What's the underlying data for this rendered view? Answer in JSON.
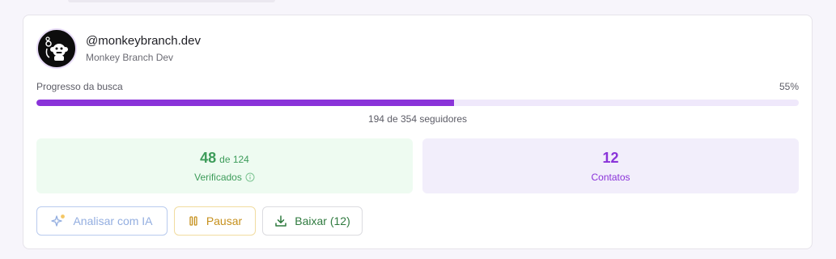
{
  "profile": {
    "handle": "@monkeybranch.dev",
    "display_name": "Monkey Branch Dev",
    "avatar_icon": "monkey-logo"
  },
  "progress": {
    "label": "Progresso da busca",
    "percent_label": "55%",
    "fraction": 0.548,
    "count_label": "194 de 354 seguidores"
  },
  "stats": {
    "verified": {
      "value": "48",
      "of_label": "de 124",
      "label": "Verificados",
      "icon": "info-icon"
    },
    "contacts": {
      "value": "12",
      "label": "Contatos"
    }
  },
  "actions": {
    "analyze_label": "Analisar com IA",
    "analyze_icon": "sparkles-icon",
    "pause_label": "Pausar",
    "pause_icon": "pause-icon",
    "download_label": "Baixar (12)",
    "download_icon": "download-icon"
  },
  "colors": {
    "accent": "#8a33d9",
    "success": "#3d9c5a",
    "warning": "#c6901c",
    "ai": "#93aee0"
  }
}
